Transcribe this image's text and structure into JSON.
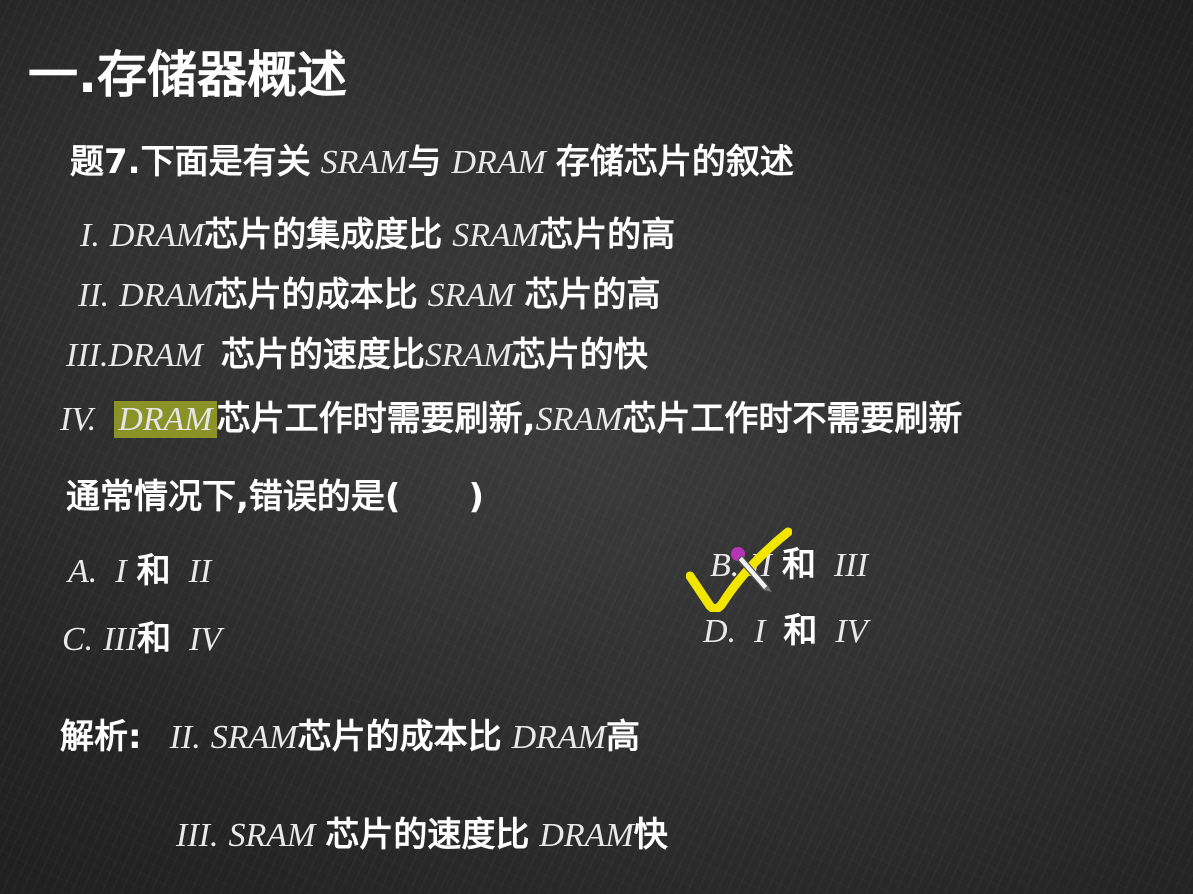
{
  "title": "一.存储器概述",
  "question": {
    "prefix": "题7.下面是有关",
    "sram": "SRAM",
    "conj": "与",
    "dram": "DRAM",
    "suffix": "存储芯片的叙述"
  },
  "statements": [
    {
      "num": "I.",
      "a": "DRAM",
      "mid": "芯片的集成度比",
      "b": "SRAM",
      "end": "芯片的高"
    },
    {
      "num": "II.",
      "a": "DRAM",
      "mid": "芯片的成本比",
      "b": "SRAM",
      "end": "芯片的高"
    },
    {
      "num": "III.",
      "a": "DRAM",
      "mid": "芯片的速度比",
      "b": "SRAM",
      "end": "芯片的快"
    },
    {
      "num": "IV.",
      "a": "DRAM",
      "mid": "芯片工作时需要刷新,",
      "b": "SRAM",
      "end": "芯片工作时不需要刷新"
    }
  ],
  "prompt": "通常情况下,错误的是(　　)",
  "options": [
    {
      "letter": "A.",
      "x": "I",
      "and": "和",
      "y": "II"
    },
    {
      "letter": "B.",
      "x": "II",
      "and": "和",
      "y": "III"
    },
    {
      "letter": "C.",
      "x": "III",
      "and": "和",
      "y": "IV"
    },
    {
      "letter": "D.",
      "x": "I",
      "and": "和",
      "y": "IV"
    }
  ],
  "analysis": {
    "label": "解析:",
    "line1": {
      "num": "II.",
      "a": "SRAM",
      "mid": "芯片的成本比",
      "b": "DRAM",
      "end": "高"
    },
    "line2": {
      "num": "III.",
      "a": "SRAM",
      "mid": "芯片的速度比",
      "b": "DRAM",
      "end": "快"
    }
  },
  "icons": {
    "check": "checkmark-icon",
    "pen": "pen-cursor-icon"
  },
  "colors": {
    "highlight": "#8a9228",
    "check": "#f2e600",
    "pen_tip": "#cc33cc",
    "board": "#2b2b2b"
  }
}
